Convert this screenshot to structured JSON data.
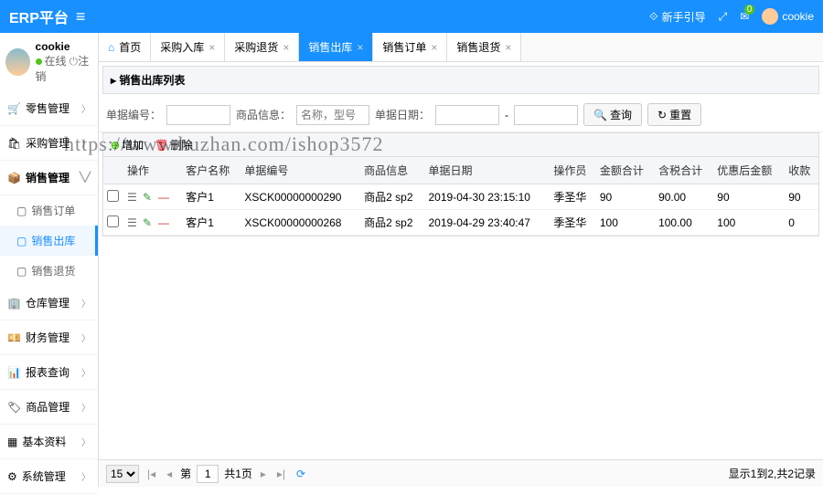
{
  "brand": "ERP平台",
  "topbar": {
    "guide": "新手引导",
    "msg_count": "0",
    "username": "cookie"
  },
  "user": {
    "name": "cookie",
    "status": "在线",
    "logout": "注销"
  },
  "nav": [
    {
      "label": "零售管理",
      "icon": "🛒",
      "expandable": true
    },
    {
      "label": "采购管理",
      "icon": "🛍",
      "expandable": true
    },
    {
      "label": "销售管理",
      "icon": "📦",
      "expandable": true,
      "bold": true,
      "open": true,
      "children": [
        {
          "label": "销售订单"
        },
        {
          "label": "销售出库",
          "active": true
        },
        {
          "label": "销售退货"
        }
      ]
    },
    {
      "label": "仓库管理",
      "icon": "🏢",
      "expandable": true
    },
    {
      "label": "财务管理",
      "icon": "💴",
      "expandable": true
    },
    {
      "label": "报表查询",
      "icon": "📊",
      "expandable": true
    },
    {
      "label": "商品管理",
      "icon": "🏷",
      "expandable": true
    },
    {
      "label": "基本资料",
      "icon": "▦",
      "expandable": true
    },
    {
      "label": "系统管理",
      "icon": "⚙",
      "expandable": true
    }
  ],
  "tabs": [
    {
      "label": "首页",
      "icon": "⌂",
      "closable": false
    },
    {
      "label": "采购入库",
      "closable": true
    },
    {
      "label": "采购退货",
      "closable": true
    },
    {
      "label": "销售出库",
      "closable": true,
      "active": true
    },
    {
      "label": "销售订单",
      "closable": true
    },
    {
      "label": "销售退货",
      "closable": true
    }
  ],
  "panel_title": "销售出库列表",
  "search": {
    "number_label": "单据编号：",
    "goods_label": "商品信息：",
    "goods_placeholder": "名称，型号",
    "date_label": "单据日期：",
    "query": "查询",
    "reset": "重置"
  },
  "toolbar": {
    "add": "增加",
    "delete": "删除"
  },
  "columns": [
    "",
    "操作",
    "客户名称",
    "单据编号",
    "商品信息",
    "单据日期",
    "操作员",
    "金额合计",
    "含税合计",
    "优惠后金额",
    "收款"
  ],
  "rows": [
    {
      "customer": "客户1",
      "number": "XSCK00000000290",
      "goods": "商品2 sp2",
      "date": "2019-04-30 23:15:10",
      "operator": "季圣华",
      "amount": "90",
      "tax": "90.00",
      "after": "90",
      "pay": "90"
    },
    {
      "customer": "客户1",
      "number": "XSCK00000000268",
      "goods": "商品2 sp2",
      "date": "2019-04-29 23:40:47",
      "operator": "季圣华",
      "amount": "100",
      "tax": "100.00",
      "after": "100",
      "pay": "0"
    }
  ],
  "pager": {
    "page_size": "15",
    "page_label_prefix": "第",
    "page": "1",
    "total_pages_label": "共1页",
    "summary": "显示1到2,共2记录"
  },
  "watermark": "https://www.huzhan.com/ishop3572"
}
